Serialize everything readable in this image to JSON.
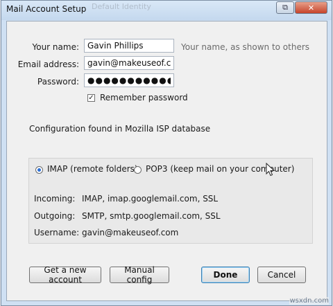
{
  "window": {
    "title": "Mail Account Setup",
    "background_hint": "Default Identity",
    "help_glyph": "⧉",
    "close_glyph": "✕"
  },
  "form": {
    "name_label": "Your name:",
    "name_value": "Gavin Phillips",
    "name_hint": "Your name, as shown to others",
    "email_label": "Email address:",
    "email_value": "gavin@makeuseof.com",
    "password_label": "Password:",
    "password_value": "●●●●●●●●●●●",
    "remember_label": "Remember password",
    "remember_checked": true
  },
  "status": {
    "message": "Configuration found in Mozilla ISP database"
  },
  "settings": {
    "protocol_options": [
      {
        "label": "IMAP (remote folders)",
        "selected": true
      },
      {
        "label": "POP3 (keep mail on your computer)",
        "selected": false
      }
    ],
    "rows": [
      {
        "label": "Incoming:",
        "value": "IMAP, imap.googlemail.com, SSL"
      },
      {
        "label": "Outgoing:",
        "value": "SMTP, smtp.googlemail.com, SSL"
      },
      {
        "label": "Username:",
        "value": "gavin@makeuseof.com"
      }
    ]
  },
  "buttons": {
    "new_account": "Get a new account",
    "manual_config": "Manual config",
    "done": "Done",
    "cancel": "Cancel"
  },
  "watermark": "wsxdn.com",
  "colors": {
    "titlebar": "#cfe0f3",
    "close_button": "#c6442b",
    "radio_accent": "#2a6fd6"
  }
}
